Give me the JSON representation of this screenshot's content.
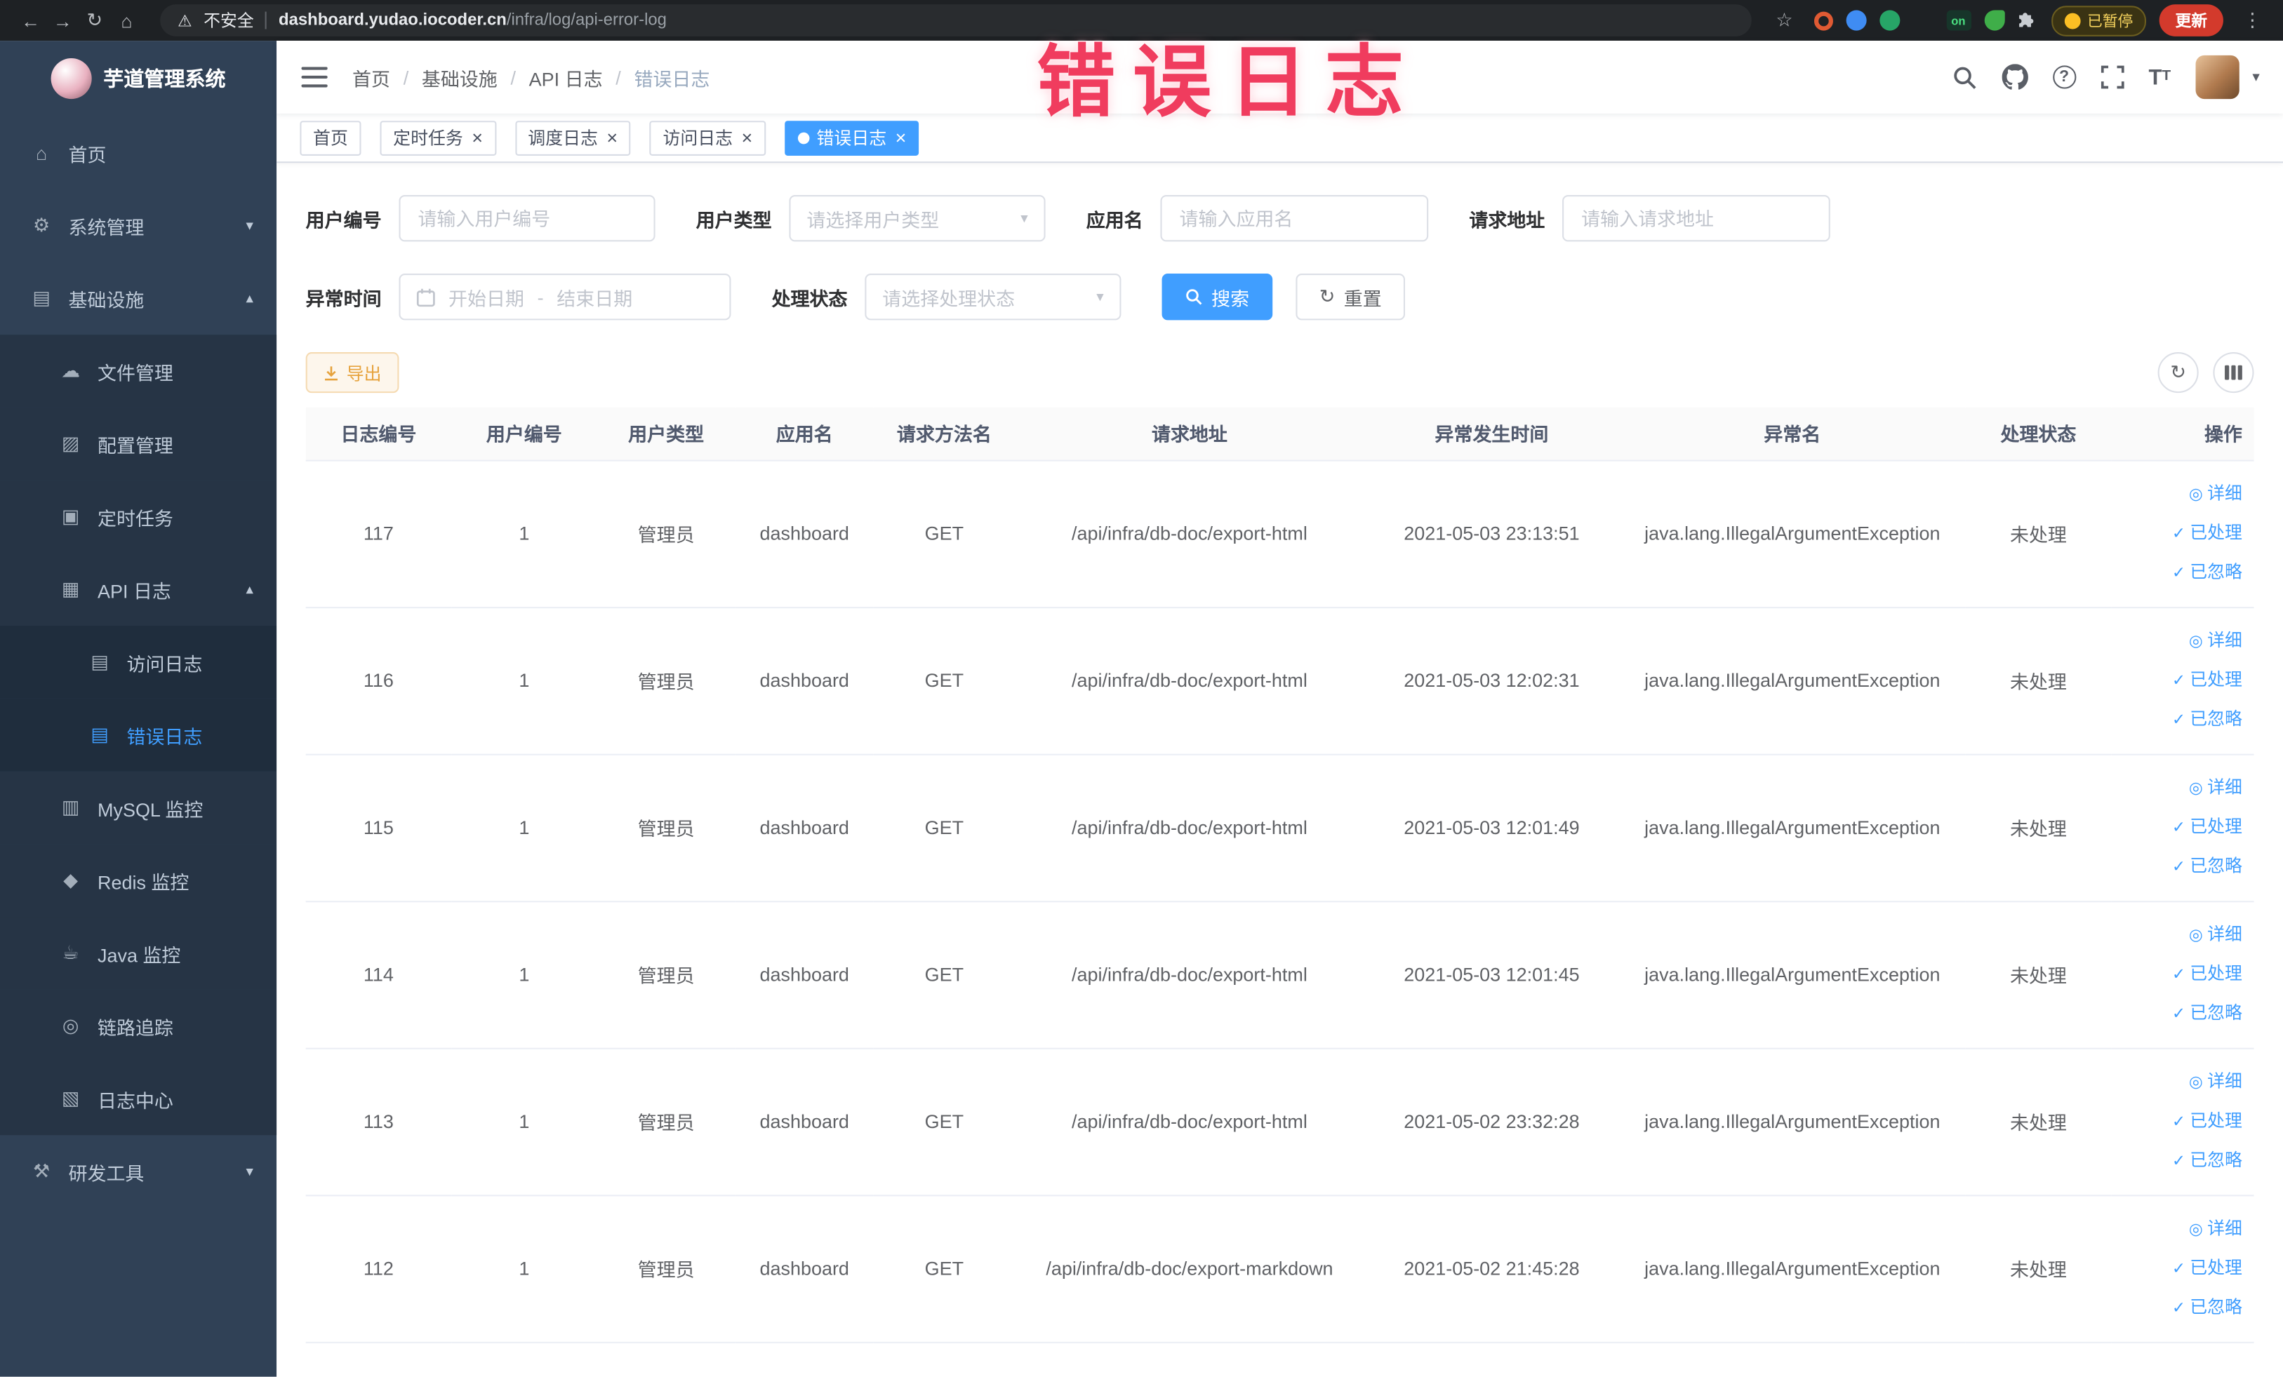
{
  "browser": {
    "security_label": "不安全",
    "url_domain": "dashboard.yudao.iocoder.cn",
    "url_path": "/infra/log/api-error-log",
    "paused_badge": "已暂停",
    "update_button": "更新",
    "extension_badge_on": "on"
  },
  "sidebar": {
    "logo_title": "芋道管理系统",
    "menu": [
      {
        "key": "home",
        "label": "首页",
        "icon": "home-icon",
        "level": 1
      },
      {
        "key": "system",
        "label": "系统管理",
        "icon": "gear-icon",
        "level": 1,
        "chevron": "down"
      },
      {
        "key": "infra",
        "label": "基础设施",
        "icon": "infra-icon",
        "level": 1,
        "chevron": "up"
      },
      {
        "key": "file",
        "label": "文件管理",
        "icon": "cloud-icon",
        "level": 2
      },
      {
        "key": "config",
        "label": "配置管理",
        "icon": "config-icon",
        "level": 2
      },
      {
        "key": "job",
        "label": "定时任务",
        "icon": "timer-icon",
        "level": 2
      },
      {
        "key": "api-log",
        "label": "API 日志",
        "icon": "api-log-icon",
        "level": 2,
        "chevron": "up"
      },
      {
        "key": "access-log",
        "label": "访问日志",
        "icon": "doc-icon",
        "level": 3
      },
      {
        "key": "error-log",
        "label": "错误日志",
        "icon": "doc-icon",
        "level": 3,
        "active": true
      },
      {
        "key": "mysql",
        "label": "MySQL 监控",
        "icon": "mysql-icon",
        "level": 2
      },
      {
        "key": "redis",
        "label": "Redis 监控",
        "icon": "redis-icon",
        "level": 2
      },
      {
        "key": "java",
        "label": "Java 监控",
        "icon": "java-icon",
        "level": 2
      },
      {
        "key": "tracing",
        "label": "链路追踪",
        "icon": "trace-icon",
        "level": 2
      },
      {
        "key": "log-center",
        "label": "日志中心",
        "icon": "log-center-icon",
        "level": 2
      },
      {
        "key": "dev-tools",
        "label": "研发工具",
        "icon": "tools-icon",
        "level": 1,
        "chevron": "down"
      }
    ]
  },
  "header": {
    "breadcrumbs": [
      "首页",
      "基础设施",
      "API 日志",
      "错误日志"
    ],
    "overlay_label": "错误日志"
  },
  "tabs": [
    {
      "key": "home",
      "label": "首页",
      "closable": false,
      "active": false
    },
    {
      "key": "job",
      "label": "定时任务",
      "closable": true,
      "active": false
    },
    {
      "key": "job-log",
      "label": "调度日志",
      "closable": true,
      "active": false
    },
    {
      "key": "access-log",
      "label": "访问日志",
      "closable": true,
      "active": false
    },
    {
      "key": "error-log",
      "label": "错误日志",
      "closable": true,
      "active": true
    }
  ],
  "filters": {
    "user_id": {
      "label": "用户编号",
      "placeholder": "请输入用户编号"
    },
    "user_type": {
      "label": "用户类型",
      "placeholder": "请选择用户类型"
    },
    "app_name": {
      "label": "应用名",
      "placeholder": "请输入应用名"
    },
    "request_url": {
      "label": "请求地址",
      "placeholder": "请输入请求地址"
    },
    "exception_time": {
      "label": "异常时间",
      "start_placeholder": "开始日期",
      "separator": "-",
      "end_placeholder": "结束日期"
    },
    "process_status": {
      "label": "处理状态",
      "placeholder": "请选择处理状态"
    },
    "search_button": "搜索",
    "reset_button": "重置"
  },
  "toolbar": {
    "export_button": "导出"
  },
  "table": {
    "columns": [
      "日志编号",
      "用户编号",
      "用户类型",
      "应用名",
      "请求方法名",
      "请求地址",
      "异常发生时间",
      "异常名",
      "处理状态",
      "操作"
    ],
    "actions": [
      {
        "key": "detail",
        "label": "详细"
      },
      {
        "key": "done",
        "label": "已处理"
      },
      {
        "key": "ignore",
        "label": "已忽略"
      }
    ],
    "rows": [
      {
        "id": "117",
        "user_id": "1",
        "user_type": "管理员",
        "app": "dashboard",
        "method": "GET",
        "url": "/api/infra/db-doc/export-html",
        "time": "2021-05-03 23:13:51",
        "exception": "java.lang.IllegalArgumentException",
        "status": "未处理"
      },
      {
        "id": "116",
        "user_id": "1",
        "user_type": "管理员",
        "app": "dashboard",
        "method": "GET",
        "url": "/api/infra/db-doc/export-html",
        "time": "2021-05-03 12:02:31",
        "exception": "java.lang.IllegalArgumentException",
        "status": "未处理"
      },
      {
        "id": "115",
        "user_id": "1",
        "user_type": "管理员",
        "app": "dashboard",
        "method": "GET",
        "url": "/api/infra/db-doc/export-html",
        "time": "2021-05-03 12:01:49",
        "exception": "java.lang.IllegalArgumentException",
        "status": "未处理"
      },
      {
        "id": "114",
        "user_id": "1",
        "user_type": "管理员",
        "app": "dashboard",
        "method": "GET",
        "url": "/api/infra/db-doc/export-html",
        "time": "2021-05-03 12:01:45",
        "exception": "java.lang.IllegalArgumentException",
        "status": "未处理"
      },
      {
        "id": "113",
        "user_id": "1",
        "user_type": "管理员",
        "app": "dashboard",
        "method": "GET",
        "url": "/api/infra/db-doc/export-html",
        "time": "2021-05-02 23:32:28",
        "exception": "java.lang.IllegalArgumentException",
        "status": "未处理"
      },
      {
        "id": "112",
        "user_id": "1",
        "user_type": "管理员",
        "app": "dashboard",
        "method": "GET",
        "url": "/api/infra/db-doc/export-markdown",
        "time": "2021-05-02 21:45:28",
        "exception": "java.lang.IllegalArgumentException",
        "status": "未处理"
      }
    ]
  },
  "colors": {
    "accent": "#409eff",
    "warning": "#e6a23c",
    "overlay_red": "#f03c5e",
    "sidebar_bg": "#304156"
  }
}
